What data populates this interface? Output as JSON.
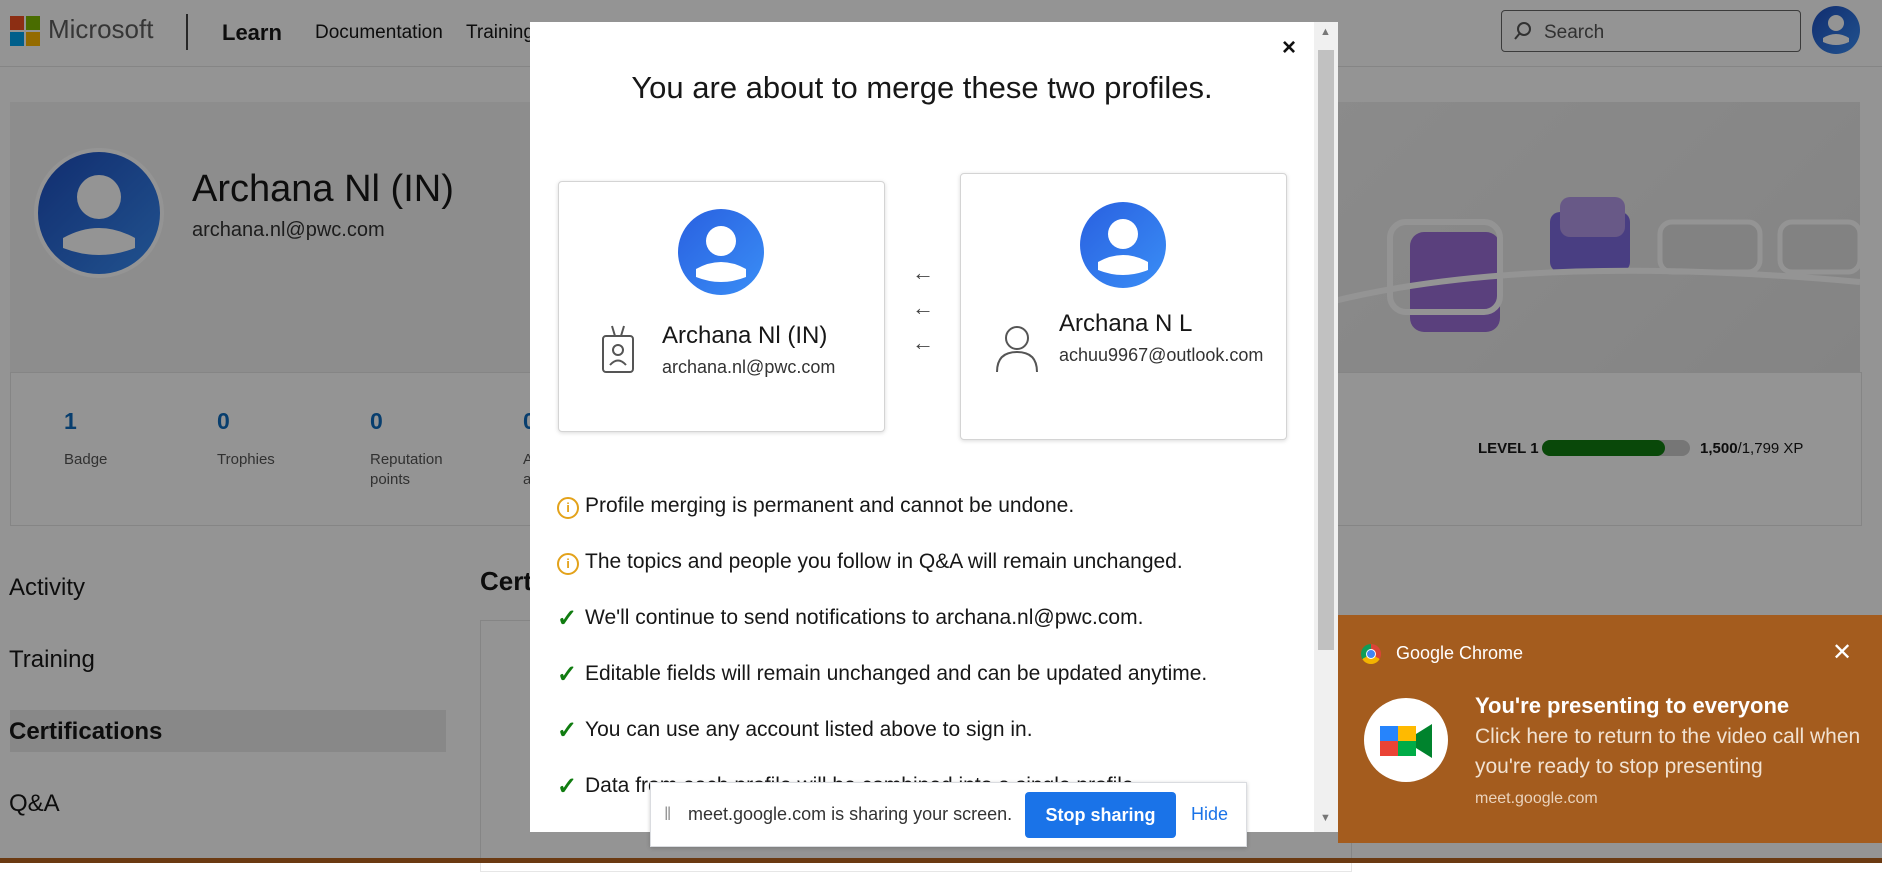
{
  "header": {
    "brand": "Microsoft",
    "product": "Learn",
    "nav": [
      "Documentation",
      "Training"
    ],
    "search_placeholder": "Search"
  },
  "profile": {
    "name": "Archana Nl (IN)",
    "email": "archana.nl@pwc.com",
    "stats": [
      {
        "value": "1",
        "label": "Badge"
      },
      {
        "value": "0",
        "label": "Trophies"
      },
      {
        "value": "0",
        "label": "Reputation points"
      },
      {
        "value": "0",
        "label": "A a"
      }
    ],
    "level": "LEVEL 1",
    "xp_current": "1,500",
    "xp_total": "/1,799 XP",
    "xp_progress": 0.834
  },
  "sidebar": {
    "items": [
      "Activity",
      "Training",
      "Certifications",
      "Q&A"
    ],
    "active": "Certifications"
  },
  "main": {
    "section_heading": "Cert"
  },
  "modal": {
    "close": "×",
    "title": "You are about to merge these two profiles.",
    "source_profile": {
      "name": "Archana Nl (IN)",
      "email": "archana.nl@pwc.com"
    },
    "target_profile": {
      "name": "Archana N L",
      "email": "achuu9967@outlook.com"
    },
    "warnings": [
      "Profile merging is permanent and cannot be undone.",
      "The topics and people you follow in Q&A will remain unchanged."
    ],
    "checks": [
      "We'll continue to send notifications to archana.nl@pwc.com.",
      "Editable fields will remain unchanged and can be updated anytime.",
      "You can use any account listed above to sign in.",
      "Data from each profile will be combined into a single profile."
    ]
  },
  "sharebar": {
    "text": "meet.google.com is sharing your screen.",
    "stop_label": "Stop sharing",
    "hide_label": "Hide"
  },
  "toast": {
    "app": "Google Chrome",
    "title": "You're presenting to everyone",
    "body": "Click here to return to the video call when you're ready to stop presenting",
    "url": "meet.google.com"
  }
}
